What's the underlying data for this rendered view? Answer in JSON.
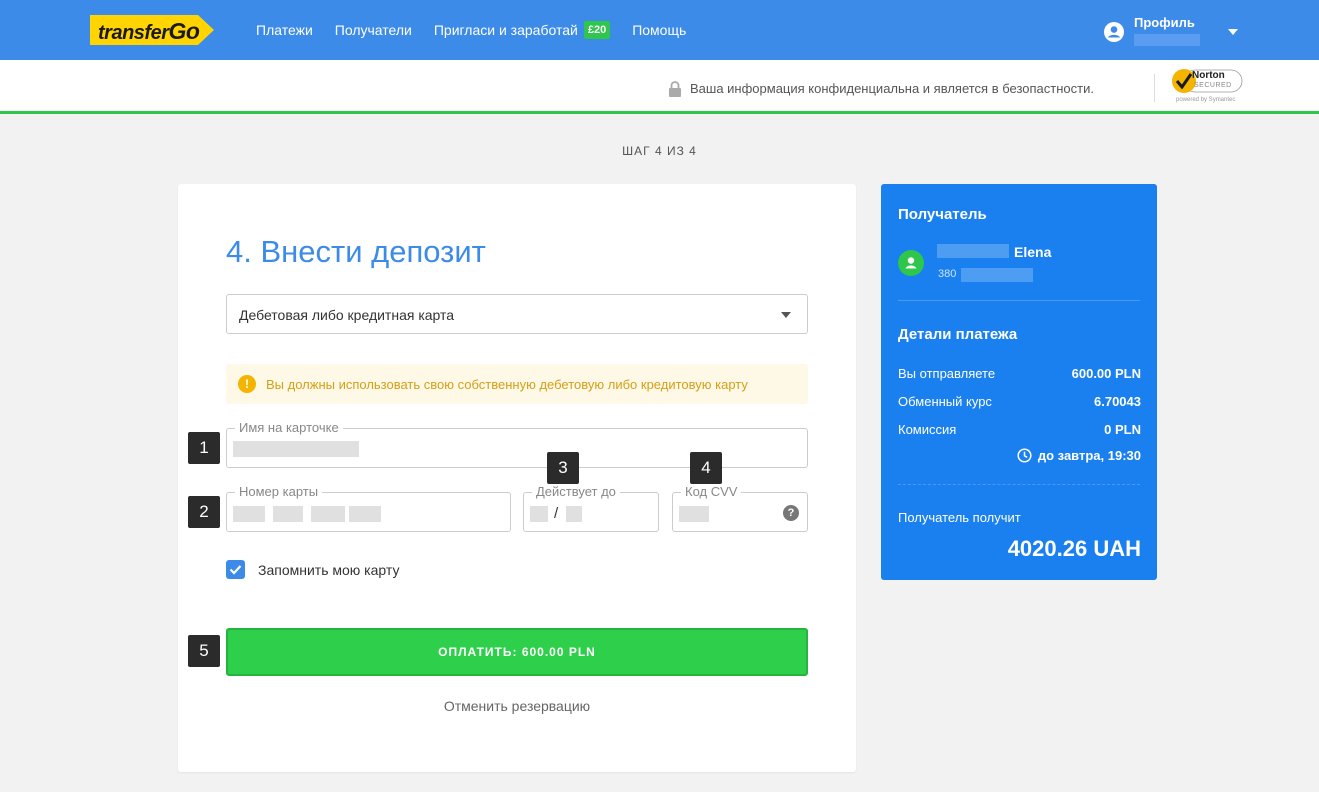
{
  "nav": {
    "logo_text_a": "transfer",
    "logo_text_b": "Go",
    "links": [
      "Платежи",
      "Получатели",
      "Пригласи и заработай",
      "Помощь"
    ],
    "invite_badge": "£20",
    "profile_label": "Профиль"
  },
  "security": {
    "text": "Ваша информация конфиденциальна и является в безопастности.",
    "norton_name": "Norton",
    "norton_secured": "SECURED",
    "norton_powered": "powered by Symantec"
  },
  "step": "ШАГ 4 ИЗ 4",
  "form": {
    "title": "4. Внести депозит",
    "payment_method": "Дебетовая либо кредитная карта",
    "warning": "Вы должны использовать свою собственную дебетовую либо кредитовую карту",
    "warning_icon": "!",
    "card_name_label": "Имя на карточке",
    "card_number_label": "Номер карты",
    "expiry_label": "Действует до",
    "expiry_separator": "/",
    "cvv_label": "Код CVV",
    "cvv_help": "?",
    "remember_label": "Запомнить мою карту",
    "remember_checked": true,
    "pay_button": "ОПЛАТИТЬ: 600.00 PLN",
    "cancel": "Отменить резервацию"
  },
  "markers": [
    "1",
    "2",
    "3",
    "4",
    "5"
  ],
  "summary": {
    "recipient_heading": "Получатель",
    "recipient_name": "Elena",
    "recipient_phone_prefix": "380",
    "details_heading": "Детали платежа",
    "rows": [
      {
        "label": "Вы отправляете",
        "value": "600.00 PLN"
      },
      {
        "label": "Обменный курс",
        "value": "6.70043"
      },
      {
        "label": "Комиссия",
        "value": "0 PLN"
      }
    ],
    "delivery_time": "до завтра, 19:30",
    "receives_label": "Получатель получит",
    "receives_amount": "4020.26 UAH"
  },
  "colors": {
    "brand_blue": "#3d8be8",
    "panel_blue": "#1a80f0",
    "success_green": "#2ed04b",
    "logo_yellow": "#ffd400"
  }
}
